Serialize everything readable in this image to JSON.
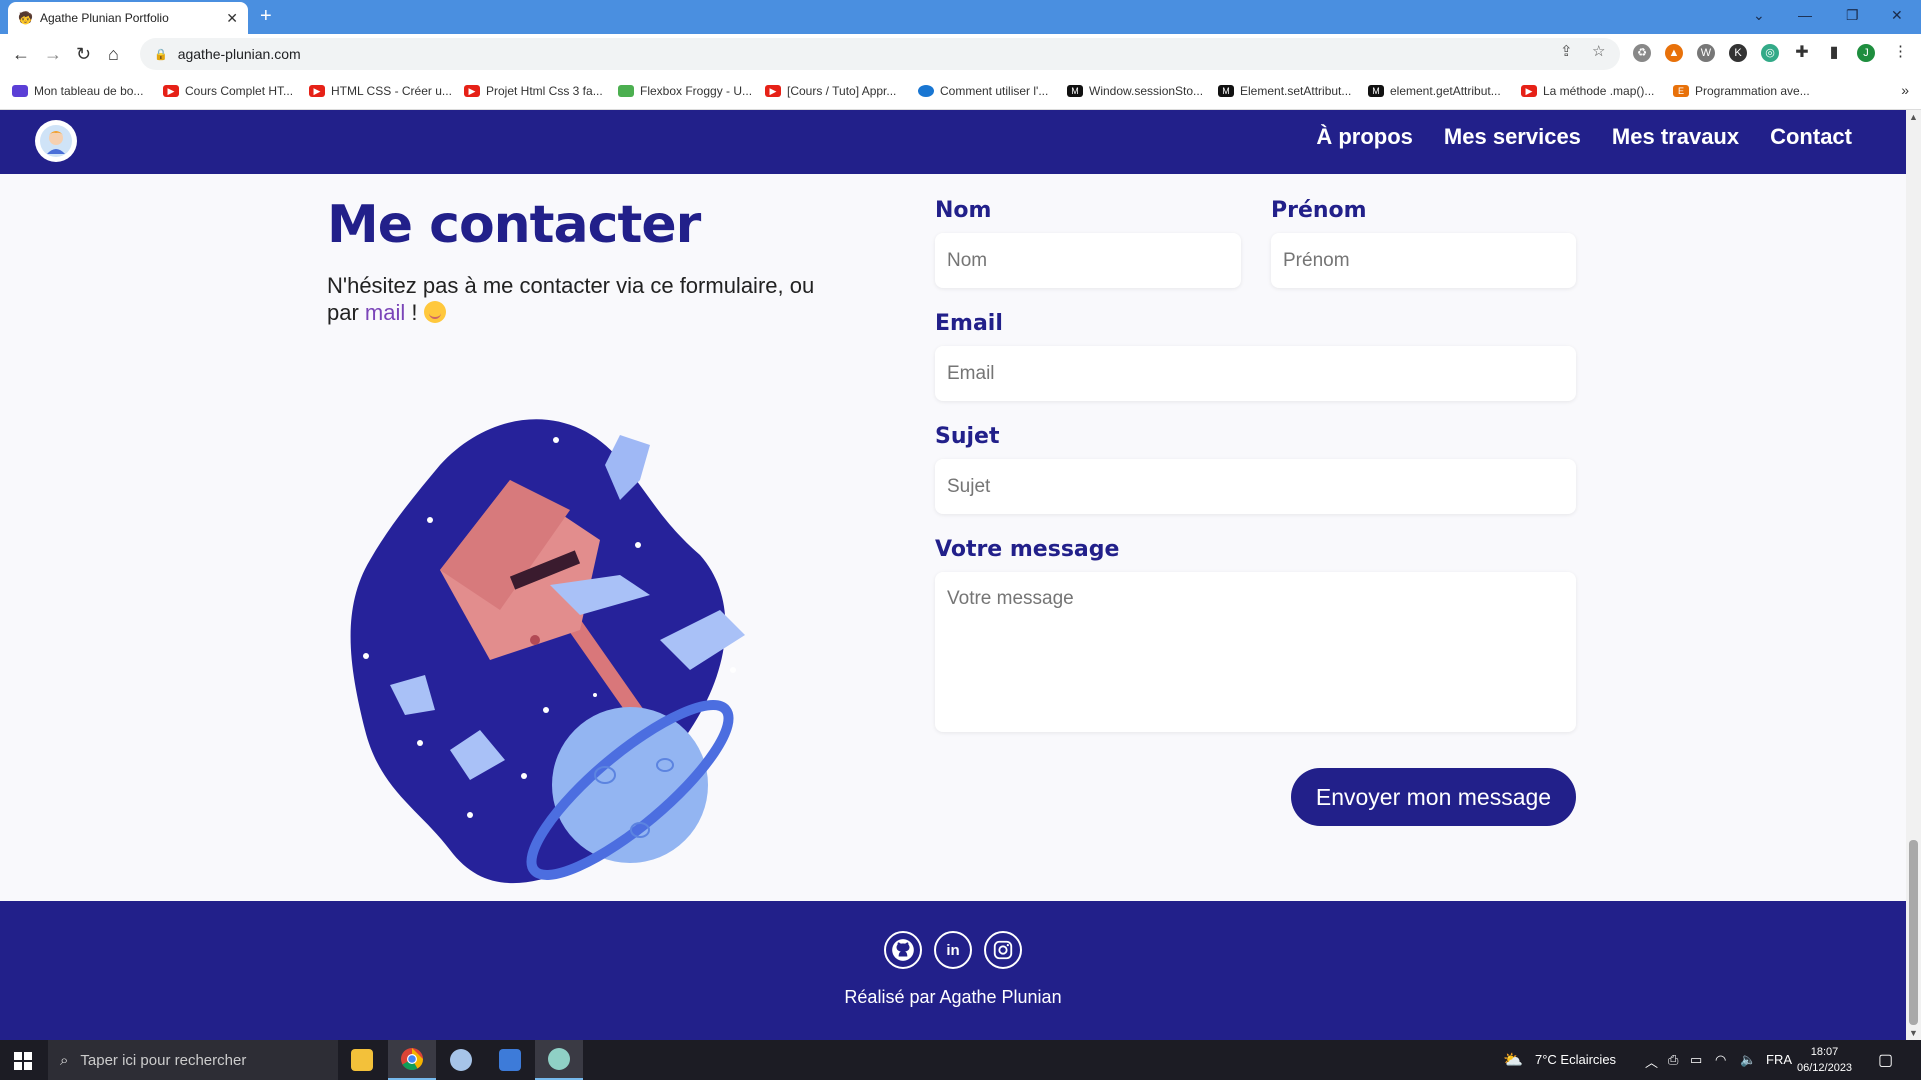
{
  "browser": {
    "tab_title": "Agathe Plunian Portfolio",
    "url": "agathe-plunian.com",
    "bookmarks": [
      {
        "label": "Mon tableau de bo...",
        "color": "#5b3fd6"
      },
      {
        "label": "Cours Complet HT...",
        "color": "#e62117"
      },
      {
        "label": "HTML CSS - Créer u...",
        "color": "#e62117"
      },
      {
        "label": "Projet Html Css 3 fa...",
        "color": "#e62117"
      },
      {
        "label": "Flexbox Froggy - U...",
        "color": "#4caf50"
      },
      {
        "label": "[Cours / Tuto] Appr...",
        "color": "#e62117"
      },
      {
        "label": "Comment utiliser l'...",
        "color": "#1976d2"
      },
      {
        "label": "Window.sessionSto...",
        "color": "#111111"
      },
      {
        "label": "Element.setAttribut...",
        "color": "#111111"
      },
      {
        "label": "element.getAttribut...",
        "color": "#111111"
      },
      {
        "label": "La méthode .map()...",
        "color": "#e62117"
      },
      {
        "label": "Programmation ave...",
        "color": "#e8710a"
      }
    ],
    "profile_initial": "J"
  },
  "site": {
    "nav": [
      "À propos",
      "Mes services",
      "Mes travaux",
      "Contact"
    ],
    "contact": {
      "title": "Me contacter",
      "intro_before": "N'hésitez pas à me contacter via ce formulaire, ou par ",
      "intro_link": "mail",
      "intro_after": " ! "
    },
    "form": {
      "nom_label": "Nom",
      "nom_placeholder": "Nom",
      "prenom_label": "Prénom",
      "prenom_placeholder": "Prénom",
      "email_label": "Email",
      "email_placeholder": "Email",
      "sujet_label": "Sujet",
      "sujet_placeholder": "Sujet",
      "message_label": "Votre message",
      "message_placeholder": "Votre message",
      "submit_label": "Envoyer mon message"
    },
    "footer": {
      "credits": "Réalisé par Agathe Plunian",
      "socials": [
        "github-icon",
        "linkedin-icon",
        "instagram-icon"
      ],
      "linkedin_text": "in"
    },
    "colors": {
      "primary": "#22208a",
      "link": "#7a44b8",
      "background": "#f9f9fc"
    }
  },
  "taskbar": {
    "search_placeholder": "Taper ici pour rechercher",
    "weather": "7°C  Eclaircies",
    "language": "FRA",
    "time": "18:07",
    "date": "06/12/2023"
  }
}
